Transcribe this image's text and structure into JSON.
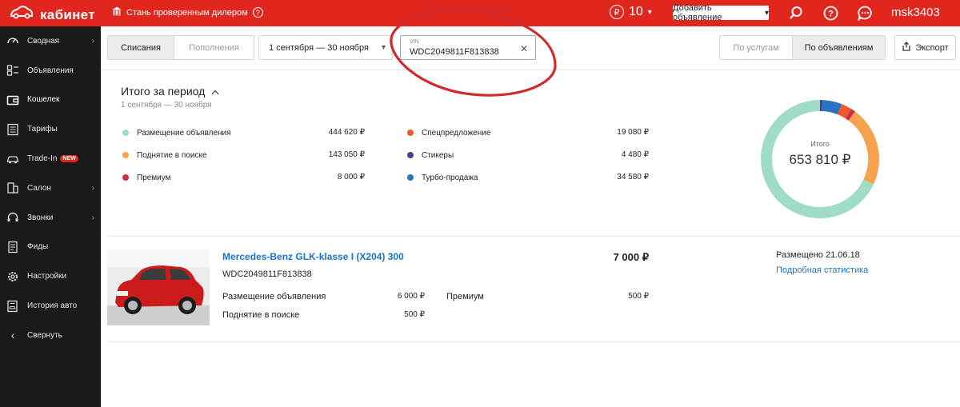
{
  "topbar": {
    "logo": "кабинет",
    "dealer_link": "Стань проверенным дилером",
    "balance": "10",
    "add_button": "Добавить объявление",
    "user": "msk3403"
  },
  "sidebar": {
    "items": [
      {
        "label": "Сводная",
        "icon": "gauge-icon",
        "arrow": true
      },
      {
        "label": "Объявления",
        "icon": "list-icon",
        "arrow": false
      },
      {
        "label": "Кошелек",
        "icon": "wallet-icon",
        "arrow": false,
        "active": true
      },
      {
        "label": "Тарифы",
        "icon": "tariff-icon",
        "arrow": false
      },
      {
        "label": "Trade-In",
        "icon": "car-icon",
        "arrow": false,
        "badge": "NEW"
      },
      {
        "label": "Салон",
        "icon": "building-icon",
        "arrow": true
      },
      {
        "label": "Звонки",
        "icon": "headset-icon",
        "arrow": true
      },
      {
        "label": "Фиды",
        "icon": "document-icon",
        "arrow": false
      },
      {
        "label": "Настройки",
        "icon": "gear-icon",
        "arrow": false
      },
      {
        "label": "История авто",
        "icon": "car-history-icon",
        "arrow": false
      },
      {
        "label": "Свернуть",
        "icon": "chevron-left-icon",
        "arrow": false
      }
    ]
  },
  "controls": {
    "tabs": [
      "Списания",
      "Пополнения"
    ],
    "active_tab": "Списания",
    "period": "1 сентября — 30 ноября",
    "vin_label": "VIN",
    "vin_value": "WDC2049811F813838",
    "view_tabs": [
      "По услугам",
      "По объявлениям"
    ],
    "active_view": "По объявлениям",
    "export": "Экспорт"
  },
  "summary": {
    "title": "Итого за период",
    "subtitle": "1 сентября — 30 ноября",
    "items": [
      {
        "label": "Размещение объявления",
        "value": "444 620 ₽",
        "color": "#9fdcc8"
      },
      {
        "label": "Поднятие в поиске",
        "value": "143 050 ₽",
        "color": "#f6a24e"
      },
      {
        "label": "Премиум",
        "value": "8 000 ₽",
        "color": "#cc2e45"
      },
      {
        "label": "Спецпредложение",
        "value": "19 080 ₽",
        "color": "#ee5a2b"
      },
      {
        "label": "Стикеры",
        "value": "4 480 ₽",
        "color": "#4a3d8f"
      },
      {
        "label": "Турбо-продажа",
        "value": "34 580 ₽",
        "color": "#2a73c2"
      }
    ],
    "total_label": "Итого",
    "total_value": "653 810 ₽"
  },
  "ad": {
    "title": "Mercedes-Benz GLK-klasse I (X204) 300",
    "vin": "WDC2049811F813838",
    "price": "7 000 ₽",
    "services": [
      {
        "label": "Размещение объявления",
        "value": "6 000 ₽"
      },
      {
        "label": "Поднятие в поиске",
        "value": "500 ₽"
      },
      {
        "label": "Премиум",
        "value": "500 ₽"
      }
    ],
    "placed": "Размещено 21.06.18",
    "stats_link": "Подробная статистика"
  },
  "colors": {
    "brand": "#e1261d",
    "link": "#1a73c9",
    "sidebar": "#1a1a1a"
  }
}
